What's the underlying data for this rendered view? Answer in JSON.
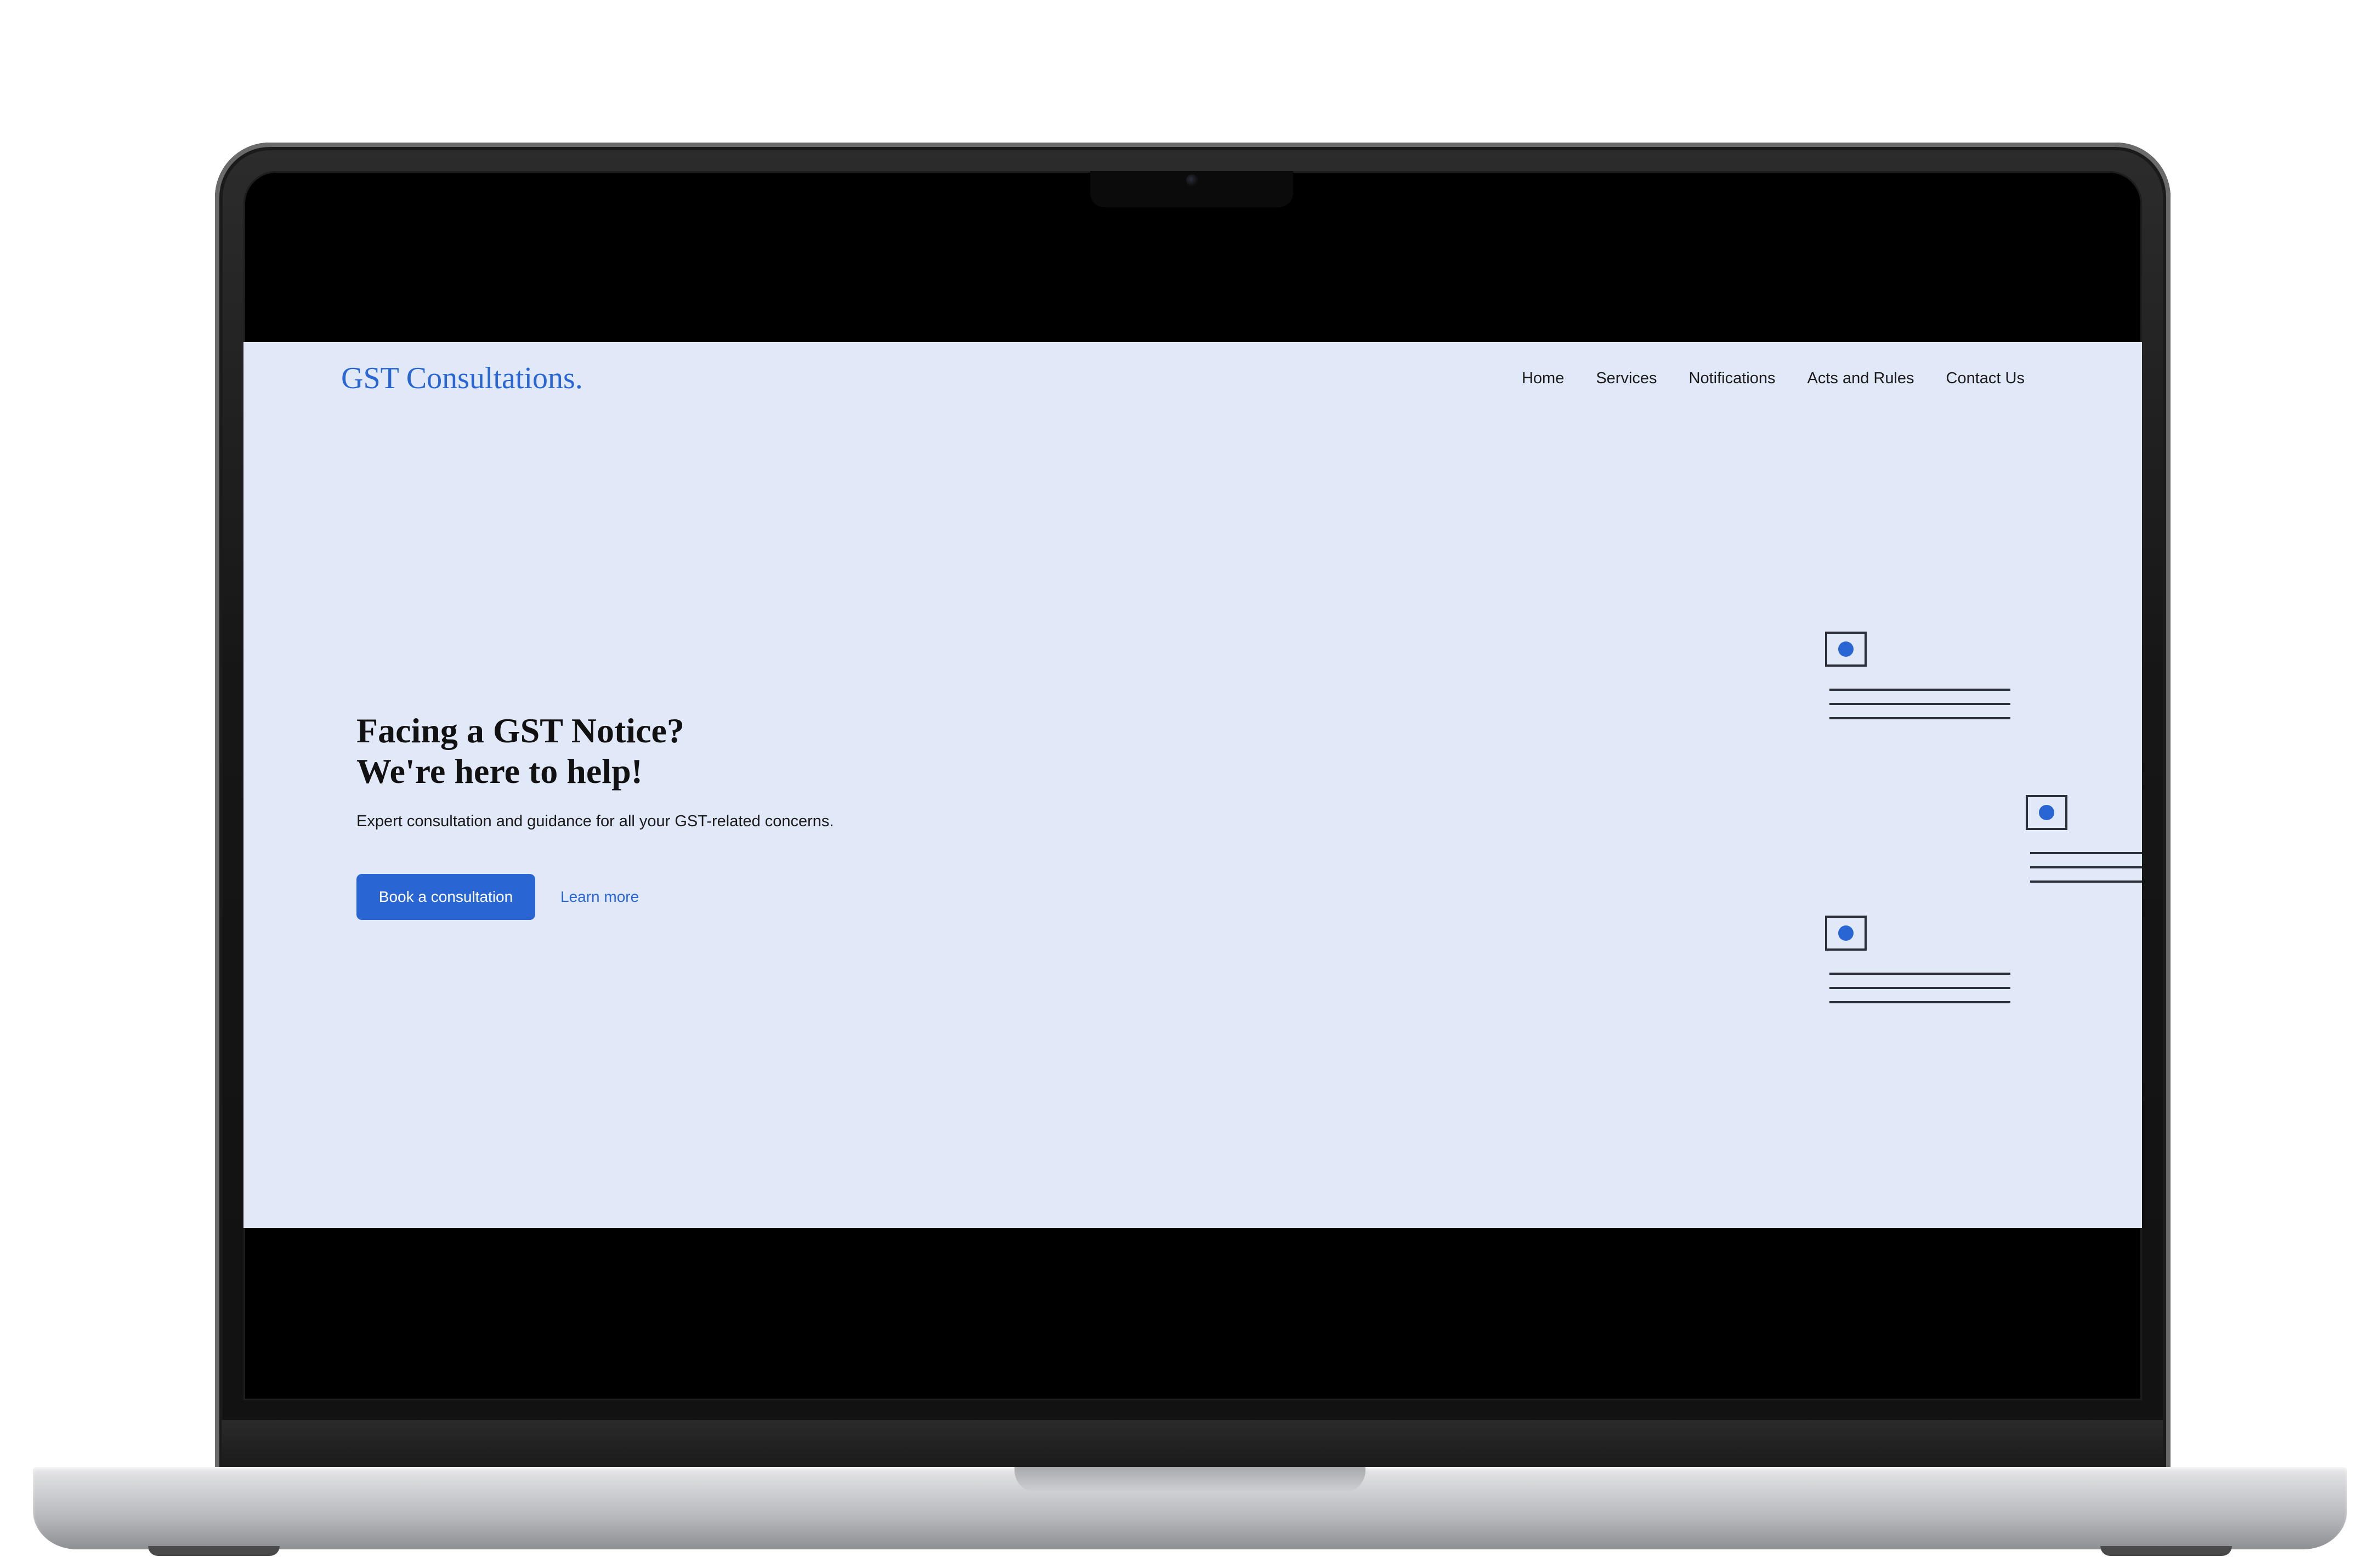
{
  "site": {
    "brand": "GST Consultations.",
    "nav": [
      {
        "label": "Home"
      },
      {
        "label": "Services"
      },
      {
        "label": "Notifications"
      },
      {
        "label": "Acts and Rules"
      },
      {
        "label": "Contact Us"
      }
    ]
  },
  "hero": {
    "title_line1": "Facing a GST Notice?",
    "title_line2": "We're here to help!",
    "subtitle": "Expert consultation and guidance for all your GST-related concerns.",
    "primary_button": "Book a consultation",
    "secondary_link": "Learn more"
  },
  "graphic": {
    "icon": "document-list-icon",
    "accent_color": "#2966d4",
    "line_color": "#2b2f3a"
  },
  "colors": {
    "accent": "#2966d4",
    "screen_background": "#e1e9f9"
  }
}
